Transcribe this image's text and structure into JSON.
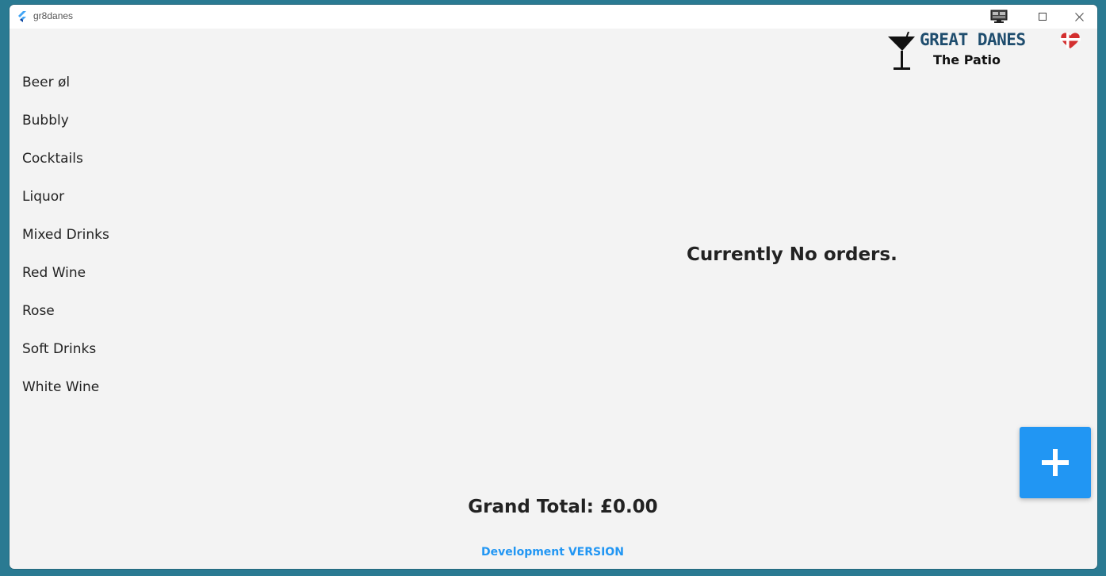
{
  "window": {
    "title": "gr8danes"
  },
  "logo": {
    "title": "GREAT DANES",
    "subtitle": "The Patio"
  },
  "categories": [
    "Beer øl",
    "Bubbly",
    "Cocktails",
    "Liquor",
    "Mixed Drinks",
    "Red Wine",
    "Rose",
    "Soft Drinks",
    "White Wine"
  ],
  "orders": {
    "empty_message": "Currently No orders."
  },
  "footer": {
    "grand_total_label": "Grand Total: ",
    "grand_total_value": "£0.00",
    "version_label": "Development VERSION"
  },
  "fab": {
    "icon": "plus-icon"
  },
  "colors": {
    "accent": "#2196f3",
    "logo_text": "#1f4d6e",
    "background": "#f3f3f3",
    "desktop": "#2a7a92"
  }
}
